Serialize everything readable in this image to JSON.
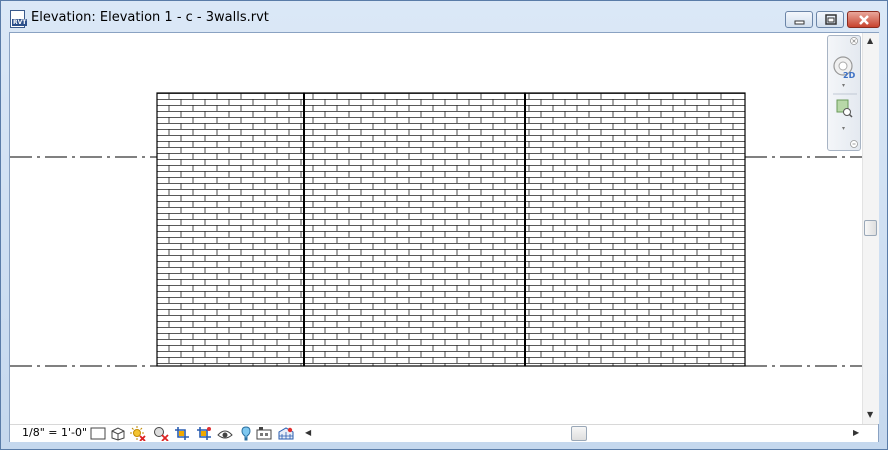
{
  "window": {
    "title": "Elevation: Elevation 1 - c - 3walls.rvt",
    "app_badge": "RVT"
  },
  "navigation_bar": {
    "wheel_badge": "2D"
  },
  "status_bar": {
    "view_scale": "1/8\" = 1'-0\"",
    "icons": [
      "detail-level-icon",
      "visual-style-icon",
      "sun-path-icon",
      "shadows-icon",
      "crop-view-icon",
      "show-crop-region-icon",
      "temporary-hide-isolate-icon",
      "reveal-hidden-elements-icon",
      "worksharing-display-icon",
      "analytical-model-icon"
    ]
  },
  "colors": {
    "title_gradient_top": "#dbe8f7",
    "title_gradient_bottom": "#c5d8ee",
    "close_button": "#c8432e",
    "drawing_lines": "#000000"
  }
}
